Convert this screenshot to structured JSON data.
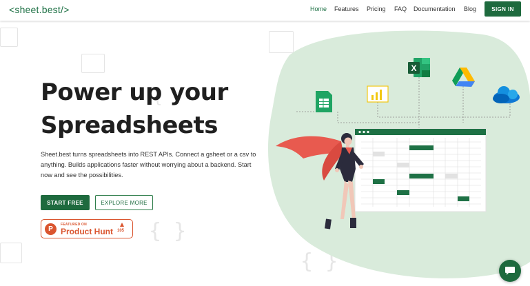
{
  "header": {
    "logo": "<sheet.best/>",
    "nav": [
      "Home",
      "Features",
      "Pricing",
      "FAQ",
      "Documentation",
      "Blog"
    ],
    "active_nav": "Home",
    "signin_label": "SIGN IN"
  },
  "hero": {
    "headline_line1": "Power up your",
    "headline_line2": "Spreadsheets",
    "lead": "Sheet.best turns spreadsheets into REST APIs. Connect a gsheet or a csv to anything. Builds applications faster without worrying about a backend. Start now and see the possibilities.",
    "start_label": "START FREE",
    "explore_label": "EXPLORE MORE"
  },
  "product_hunt": {
    "small": "FEATURED ON",
    "big": "Product Hunt",
    "votes": "105",
    "letter": "P"
  },
  "illustration": {
    "icons": [
      "google-sheets-icon",
      "power-bi-icon",
      "excel-icon",
      "google-drive-icon",
      "onedrive-icon"
    ],
    "colors": {
      "blob": "#d7ead9",
      "sheet_header": "#1e7145",
      "cape": "#e85a4f",
      "accent": "#1e6a3e"
    }
  },
  "chat": {
    "icon": "chat-bubble-icon"
  }
}
